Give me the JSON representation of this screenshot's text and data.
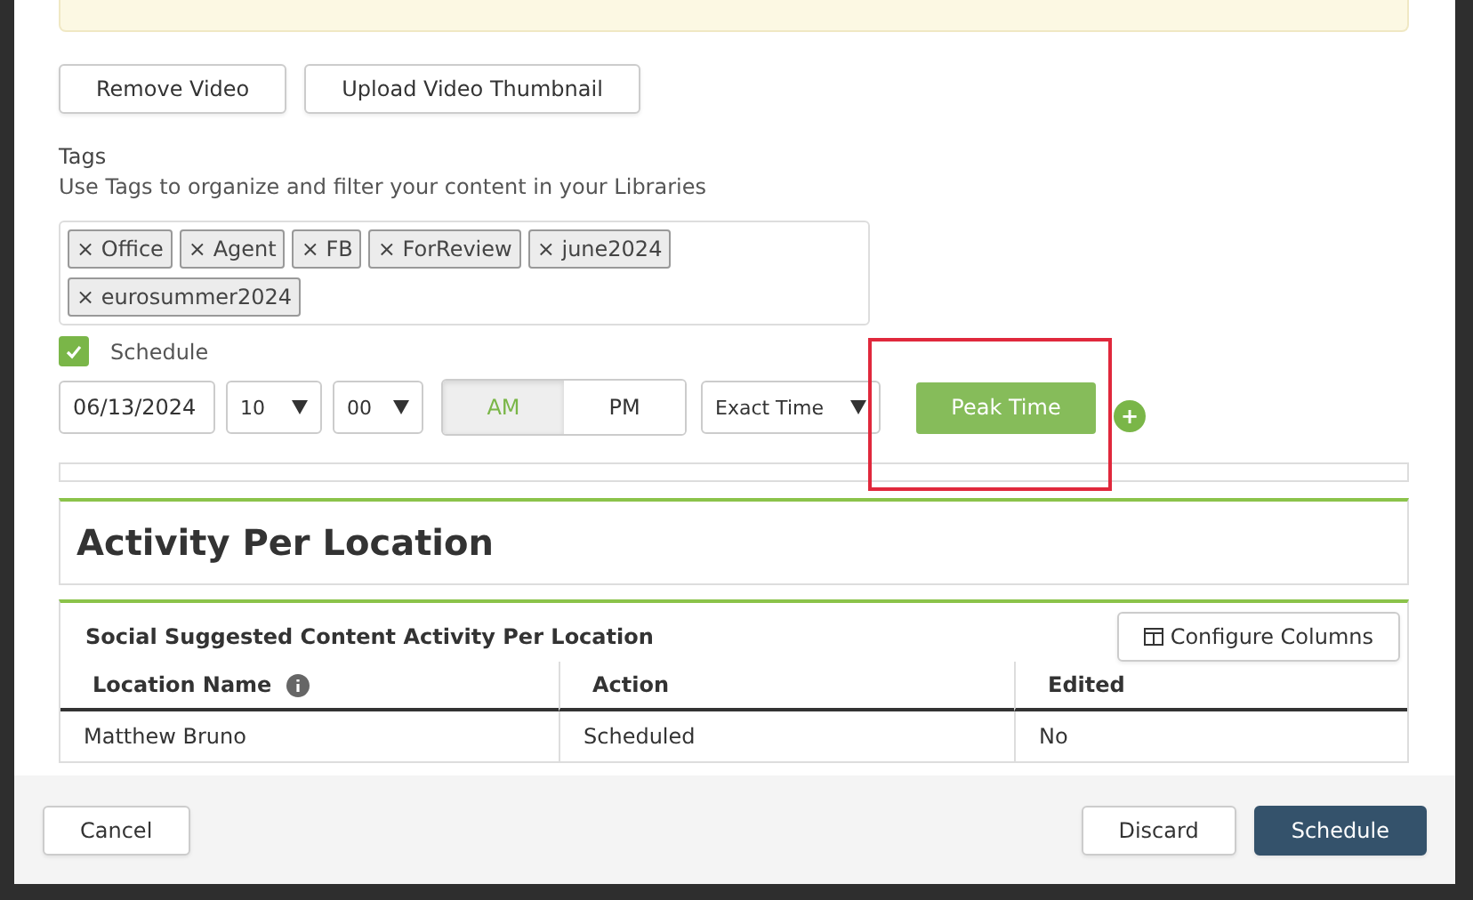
{
  "video_buttons": [
    "Remove Video",
    "Upload Video Thumbnail"
  ],
  "tags": {
    "title": "Tags",
    "help": "Use Tags to organize and filter your content in your Libraries",
    "remove_symbol": "×",
    "items": [
      "Office",
      "Agent",
      "FB",
      "ForReview",
      "june2024",
      "eurosummer2024"
    ]
  },
  "schedule": {
    "label": "Schedule",
    "checked": true,
    "date": "06/13/2024",
    "hour": "10",
    "minute": "00",
    "periods": [
      {
        "label": "AM",
        "selected": true
      },
      {
        "label": "PM",
        "selected": false
      }
    ],
    "timing": "Exact Time",
    "peak_button": "Peak Time",
    "plus_symbol": "+"
  },
  "activity": {
    "title": "Activity Per Location",
    "table_title": "Social Suggested Content Activity Per Location",
    "configure_button": "Configure Columns",
    "columns": [
      "Location Name",
      "Action",
      "Edited"
    ],
    "rows": [
      [
        "Matthew Bruno",
        "Scheduled",
        "No"
      ]
    ]
  },
  "footer": {
    "left": "Cancel",
    "right": [
      "Discard",
      "Schedule"
    ]
  }
}
